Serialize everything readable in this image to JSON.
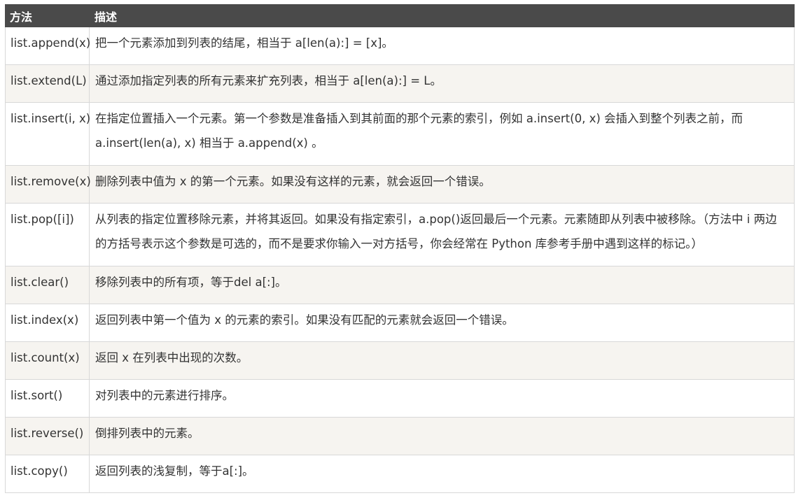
{
  "table": {
    "headers": {
      "method": "方法",
      "description": "描述"
    },
    "rows": [
      {
        "method": "list.append(x)",
        "description": "把一个元素添加到列表的结尾，相当于 a[len(a):] = [x]。"
      },
      {
        "method": "list.extend(L)",
        "description": "通过添加指定列表的所有元素来扩充列表，相当于 a[len(a):] = L。"
      },
      {
        "method": "list.insert(i, x)",
        "description": "在指定位置插入一个元素。第一个参数是准备插入到其前面的那个元素的索引，例如 a.insert(0, x) 会插入到整个列表之前，而 a.insert(len(a), x) 相当于 a.append(x) 。"
      },
      {
        "method": "list.remove(x)",
        "description": "删除列表中值为 x 的第一个元素。如果没有这样的元素，就会返回一个错误。"
      },
      {
        "method": "list.pop([i])",
        "description": "从列表的指定位置移除元素，并将其返回。如果没有指定索引，a.pop()返回最后一个元素。元素随即从列表中被移除。（方法中 i 两边的方括号表示这个参数是可选的，而不是要求你输入一对方括号，你会经常在 Python 库参考手册中遇到这样的标记。）"
      },
      {
        "method": "list.clear()",
        "description": "移除列表中的所有项，等于del a[:]。"
      },
      {
        "method": "list.index(x)",
        "description": "返回列表中第一个值为 x 的元素的索引。如果没有匹配的元素就会返回一个错误。"
      },
      {
        "method": "list.count(x)",
        "description": "返回 x 在列表中出现的次数。"
      },
      {
        "method": "list.sort()",
        "description": "对列表中的元素进行排序。"
      },
      {
        "method": "list.reverse()",
        "description": "倒排列表中的元素。"
      },
      {
        "method": "list.copy()",
        "description": "返回列表的浅复制，等于a[:]。"
      }
    ]
  }
}
